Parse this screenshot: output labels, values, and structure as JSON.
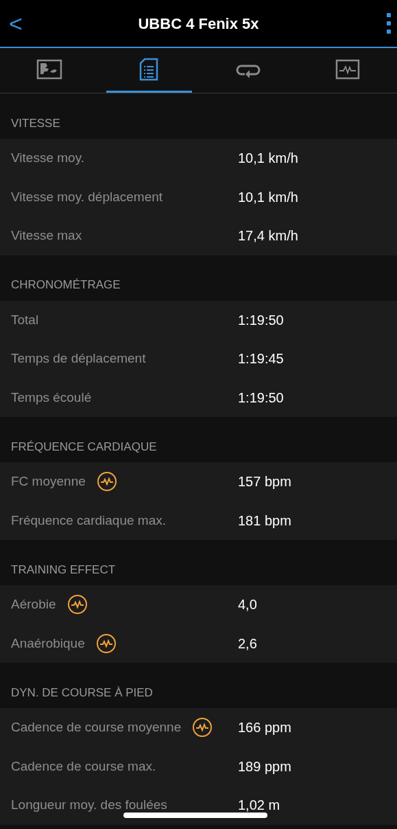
{
  "header": {
    "back": "<",
    "title": "UBBC 4 Fenix 5x"
  },
  "tabs": [
    {
      "kind": "map",
      "selected": false
    },
    {
      "kind": "details",
      "selected": true
    },
    {
      "kind": "laps",
      "selected": false
    },
    {
      "kind": "charts",
      "selected": false
    }
  ],
  "sections": [
    {
      "title": "VITESSE",
      "rows": [
        {
          "label": "Vitesse moy.",
          "value": "10,1 km/h",
          "info_icon": false
        },
        {
          "label": "Vitesse moy. déplacement",
          "value": "10,1 km/h",
          "info_icon": false
        },
        {
          "label": "Vitesse max",
          "value": "17,4 km/h",
          "info_icon": false
        }
      ]
    },
    {
      "title": "CHRONOMÉTRAGE",
      "rows": [
        {
          "label": "Total",
          "value": "1:19:50",
          "info_icon": false
        },
        {
          "label": "Temps de déplacement",
          "value": "1:19:45",
          "info_icon": false
        },
        {
          "label": "Temps écoulé",
          "value": "1:19:50",
          "info_icon": false
        }
      ]
    },
    {
      "title": "FRÉQUENCE CARDIAQUE",
      "rows": [
        {
          "label": "FC moyenne",
          "value": "157 bpm",
          "info_icon": true
        },
        {
          "label": "Fréquence cardiaque max.",
          "value": "181 bpm",
          "info_icon": false
        }
      ]
    },
    {
      "title": "TRAINING EFFECT",
      "rows": [
        {
          "label": "Aérobie",
          "value": "4,0",
          "info_icon": true
        },
        {
          "label": "Anaérobique",
          "value": "2,6",
          "info_icon": true
        }
      ]
    },
    {
      "title": "DYN. DE COURSE À PIED",
      "rows": [
        {
          "label": "Cadence de course moyenne",
          "value": "166 ppm",
          "info_icon": true
        },
        {
          "label": "Cadence de course max.",
          "value": "189 ppm",
          "info_icon": false
        },
        {
          "label": "Longueur moy. des foulées",
          "value": "1,02 m",
          "info_icon": false
        }
      ]
    }
  ]
}
